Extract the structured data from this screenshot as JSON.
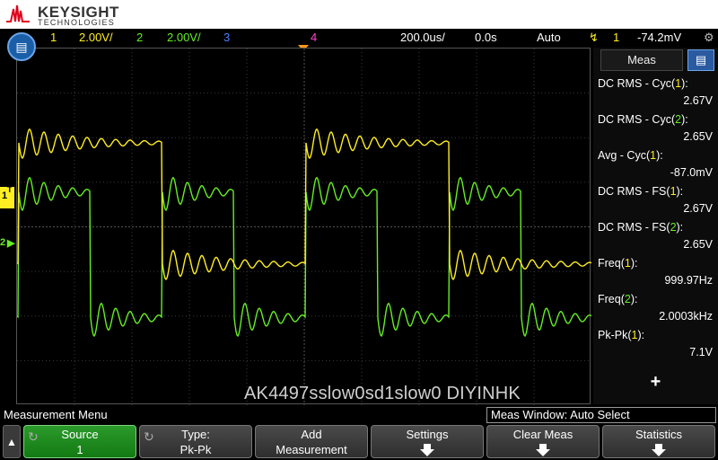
{
  "brand": {
    "name": "KEYSIGHT",
    "sub": "TECHNOLOGIES"
  },
  "status": {
    "ch1_num": "1",
    "ch1_scale": "2.00V/",
    "ch2_num": "2",
    "ch2_scale": "2.00V/",
    "ch3_num": "3",
    "ch4_num": "4",
    "timebase": "200.0us/",
    "delay": "0.0s",
    "trig_mode": "Auto",
    "trig_src": "1",
    "trig_level": "-74.2mV"
  },
  "colors": {
    "ch1": "#ffee22",
    "ch2": "#66ee22",
    "ch3": "#4d7dff",
    "ch4": "#ff44cc"
  },
  "markers": {
    "ch1": "1",
    "ch2": "2",
    "trigger": "T"
  },
  "watermark": "AK4497sslow0sd1slow0 DIYINHK",
  "meas": {
    "tab": "Meas",
    "items": [
      {
        "name": "DC RMS - Cyc(",
        "src": "1",
        "close": "):",
        "value": "2.67V",
        "ch": 1
      },
      {
        "name": "DC RMS - Cyc(",
        "src": "2",
        "close": "):",
        "value": "2.65V",
        "ch": 2
      },
      {
        "name": "Avg - Cyc(",
        "src": "1",
        "close": "):",
        "value": "-87.0mV",
        "ch": 1
      },
      {
        "name": "DC RMS - FS(",
        "src": "1",
        "close": "):",
        "value": "2.67V",
        "ch": 1
      },
      {
        "name": "DC RMS - FS(",
        "src": "2",
        "close": "):",
        "value": "2.65V",
        "ch": 2
      },
      {
        "name": "Freq(",
        "src": "1",
        "close": "):",
        "value": "999.97Hz",
        "ch": 1
      },
      {
        "name": "Freq(",
        "src": "2",
        "close": "):",
        "value": "2.0003kHz",
        "ch": 2
      },
      {
        "name": "Pk-Pk(",
        "src": "1",
        "close": "):",
        "value": "7.1V",
        "ch": 1
      }
    ],
    "add": "+"
  },
  "menu": {
    "title": "Measurement Menu",
    "window": "Meas Window: Auto Select",
    "softkeys": [
      {
        "l1": "Source",
        "l2": "1"
      },
      {
        "l1": "Type:",
        "l2": "Pk-Pk"
      },
      {
        "l1": "Add",
        "l2": "Measurement"
      },
      {
        "l1": "Settings",
        "l2": ""
      },
      {
        "l1": "Clear Meas",
        "l2": ""
      },
      {
        "l1": "Statistics",
        "l2": ""
      }
    ]
  }
}
